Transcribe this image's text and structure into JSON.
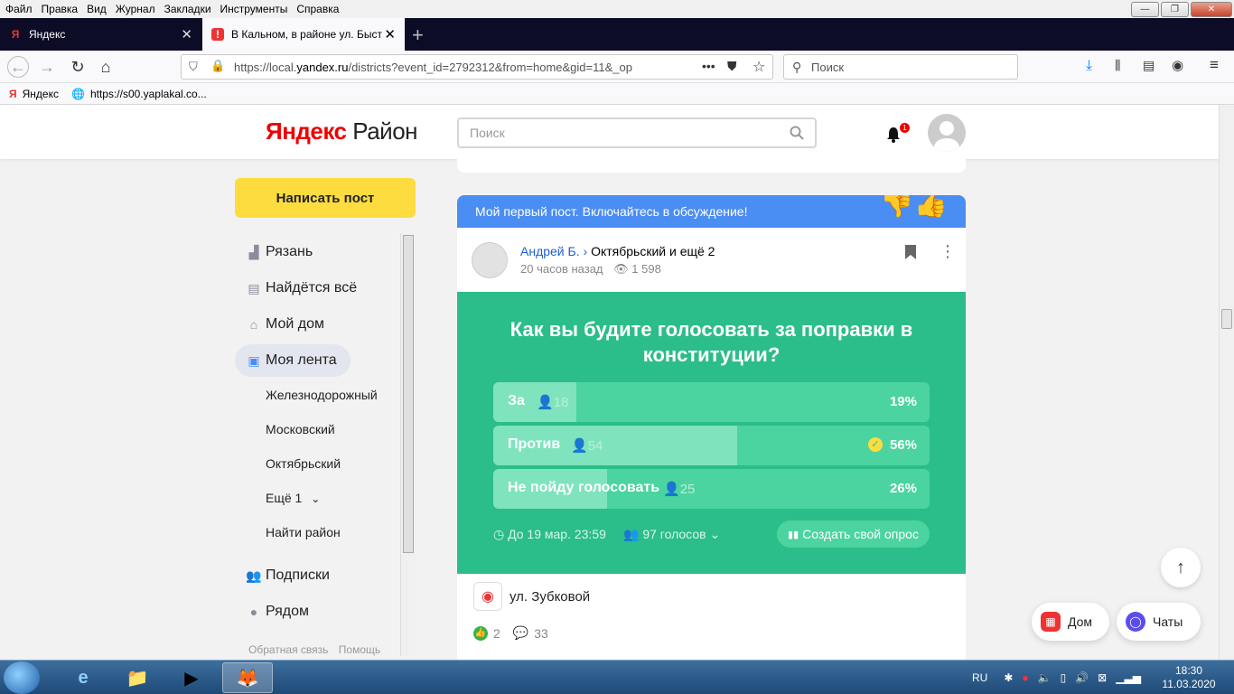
{
  "menubar": [
    "Файл",
    "Правка",
    "Вид",
    "Журнал",
    "Закладки",
    "Инструменты",
    "Справка"
  ],
  "tabs": [
    {
      "title": "Яндекс",
      "favicon": "Я"
    },
    {
      "title": "В Кальном, в районе ул. Быст",
      "favicon": "!"
    }
  ],
  "navbar": {
    "url_prefix": "https://local.",
    "url_domain": "yandex.ru",
    "url_rest": "/districts?event_id=2792312&from=home&gid=11&_op",
    "search_placeholder": "Поиск"
  },
  "bookmarks": [
    {
      "label": "Яндекс",
      "icon": "Я"
    },
    {
      "label": "https://s00.yaplakal.co...",
      "icon": "🌐"
    }
  ],
  "header": {
    "logo_yandex": "Яндекс",
    "logo_rayon": "Район",
    "search_placeholder": "Поиск",
    "notifications_count": "1"
  },
  "sidebar": {
    "write_button": "Написать пост",
    "items": [
      {
        "label": "Рязань",
        "icon": "city-icon"
      },
      {
        "label": "Найдётся всё",
        "icon": "catalog-icon"
      },
      {
        "label": "Мой дом",
        "icon": "home-icon"
      },
      {
        "label": "Моя лента",
        "icon": "feed-icon"
      },
      {
        "label": "Подписки",
        "icon": "people-icon"
      },
      {
        "label": "Рядом",
        "icon": "pin-icon"
      }
    ],
    "subitems": [
      "Железнодорожный",
      "Московский",
      "Октябрьский",
      "Ещё 1",
      "Найти район"
    ],
    "footer_links": [
      "Обратная связь",
      "Помощь"
    ]
  },
  "post": {
    "banner": "Мой первый пост. Включайтесь в обсуждение!",
    "author": "Андрей Б.",
    "author_arrow": "›",
    "districts": "Октябрьский и ещё 2",
    "time": "20 часов назад",
    "views": "1 598",
    "poll": {
      "question": "Как вы будите голосовать за поправки в конституции?",
      "options": [
        {
          "label": "За",
          "votes": "18",
          "percent": "19%",
          "fraction": 0.19,
          "selected": false
        },
        {
          "label": "Против",
          "votes": "54",
          "percent": "56%",
          "fraction": 0.56,
          "selected": true
        },
        {
          "label": "Не пойду голосовать",
          "votes": "25",
          "percent": "26%",
          "fraction": 0.26,
          "selected": false
        }
      ],
      "deadline": "До 19 мар. 23:59",
      "total_votes": "97 голосов",
      "create_button": "Создать свой опрос"
    },
    "location": "ул. Зубковой",
    "likes": "2",
    "comments": "33"
  },
  "floating": {
    "home_button": "Дом",
    "chats_button": "Чаты"
  },
  "taskbar": {
    "lang": "RU",
    "time": "18:30",
    "date": "11.03.2020"
  },
  "colors": {
    "poll_bg": "#2bbd8a",
    "banner_bg": "#4a8df3",
    "write_button": "#fddc3f"
  }
}
